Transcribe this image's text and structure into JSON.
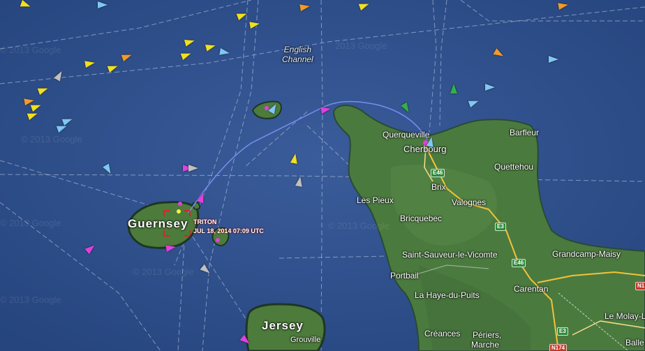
{
  "map": {
    "sea_label": [
      "English",
      "Channel"
    ],
    "watermarks": [
      "© 2013 Google",
      "© 2013 Google",
      "© 2013 Google",
      "© 2013 Google",
      "© 2013 Google",
      "© 2013 Google",
      "2013 Google"
    ],
    "islands": {
      "guernsey": "Guernsey",
      "jersey": "Jersey"
    },
    "places": {
      "querqueville": "Querqueville",
      "cherbourg": "Cherbourg",
      "barfleur": "Barfleur",
      "quettehou": "Quettehou",
      "brix": "Brix",
      "les_pieux": "Les Pieux",
      "valognes": "Valognes",
      "bricquebec": "Bricquebec",
      "saint_sauveur": "Saint-Sauveur-le-Vicomte",
      "grandcamp": "Grandcamp-Maisy",
      "portbail": "Portbail",
      "carentan": "Carentan",
      "la_haye": "La Haye-du-Puits",
      "le_molay": "Le Molay-L",
      "creances": "Créances",
      "periers": "Périers,",
      "marche": "Marche",
      "grouville": "Grouville",
      "balle": "Balle"
    },
    "roads": {
      "e46_a": "E46",
      "e3_a": "E3",
      "e46_b": "E46",
      "e3_b": "E3",
      "n174": "N174",
      "n1": "N1"
    },
    "vessel": {
      "name": "TRITON",
      "timestamp": "JUL 18, 2014 07:09 UTC"
    },
    "colors": {
      "sea": "#2a4a86",
      "land": "#4a7a3e",
      "track": "#7a8cf0",
      "marker": "#e0202a"
    }
  }
}
